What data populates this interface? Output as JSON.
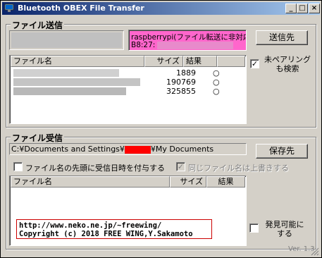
{
  "window": {
    "title": "Bluetooth OBEX File Transfer",
    "min": "_",
    "max": "□",
    "close": "×"
  },
  "send": {
    "group_label": "ファイル送信",
    "device_line1": "raspberrypi(ファイル転送に非対応",
    "device_line2": "B8:27:",
    "send_button": "送信先",
    "columns": [
      "ファイル名",
      "サイズ",
      "結果"
    ],
    "rows": [
      {
        "size": "1889",
        "result": "○"
      },
      {
        "size": "190769",
        "result": "○"
      },
      {
        "size": "325855",
        "result": "○"
      }
    ],
    "unpaired_label": "未ペアリングも検索",
    "unpaired_checked": "✓"
  },
  "receive": {
    "group_label": "ファイル受信",
    "path_prefix": "C:¥Documents and Settings¥",
    "path_suffix": "¥My Documents",
    "save_button": "保存先",
    "prefix_date_label": "ファイル名の先頭に受信日時を付与する",
    "overwrite_label": "同じファイル名は上書きする",
    "overwrite_checked": "✓",
    "columns": [
      "ファイル名",
      "サイズ",
      "結果"
    ],
    "url": "http://www.neko.ne.jp/~freewing/",
    "copyright": "Copyright (c) 2018 FREE WING,Y.Sakamoto",
    "discoverable_label": "発見可能にする",
    "version": "Ver. 1.3"
  },
  "colors": {
    "title_start": "#0a246a",
    "title_end": "#a6caf0",
    "device_bg": "#ff66cc",
    "redact": "#ff0000"
  }
}
